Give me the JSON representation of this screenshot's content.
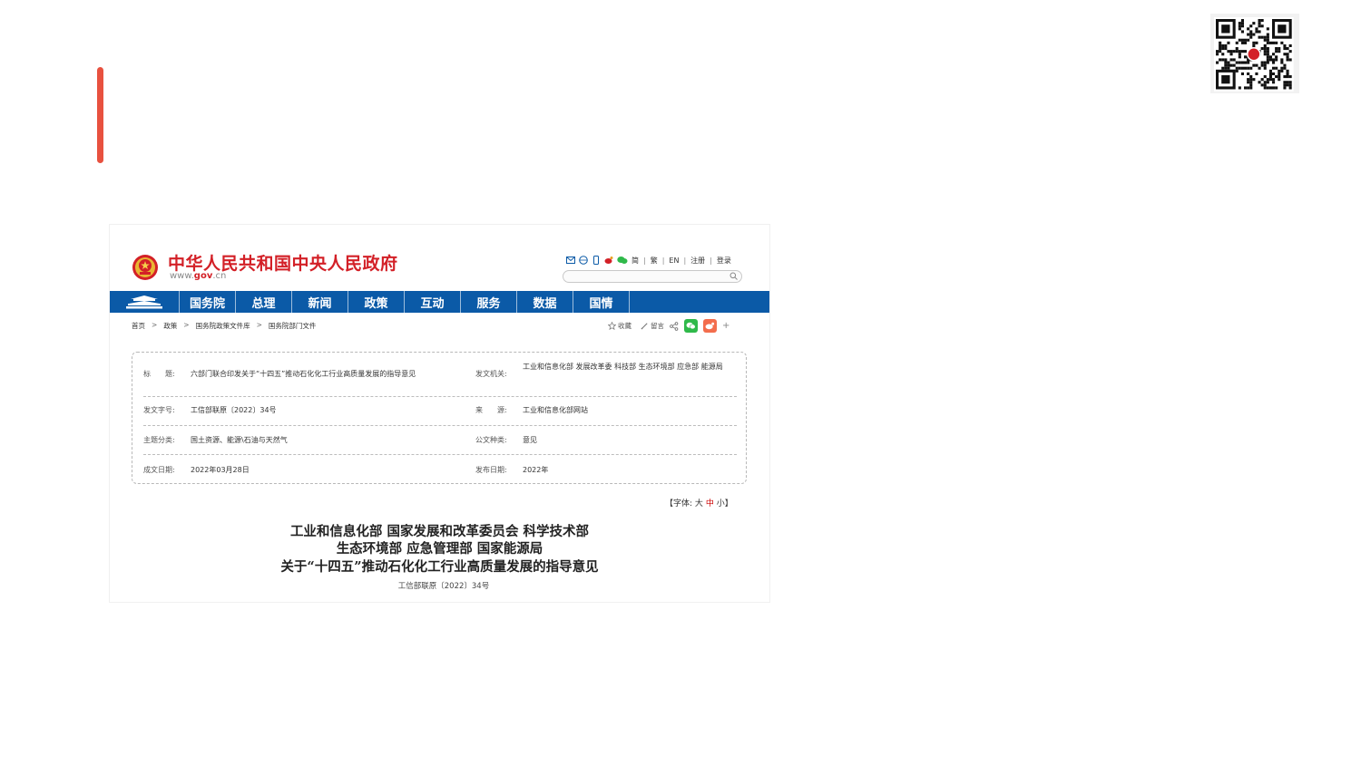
{
  "colors": {
    "accent": "#e8513f",
    "gov_blue": "#0b5aa7",
    "gov_red": "#d32027",
    "wechat_green": "#2fb94a",
    "weibo_orange": "#f36d4d"
  },
  "site": {
    "title": "中华人民共和国中央人民政府",
    "url_prefix": "www.",
    "url_domain": "gov",
    "url_suffix": ".cn",
    "tools": {
      "simplified": "简",
      "traditional": "繁",
      "english": "EN",
      "register": "注册",
      "login": "登录"
    },
    "search_placeholder": ""
  },
  "nav": {
    "items": [
      "国务院",
      "总理",
      "新闻",
      "政策",
      "互动",
      "服务",
      "数据",
      "国情"
    ]
  },
  "breadcrumb": {
    "items": [
      "首页",
      "政策",
      "国务院政策文件库",
      "国务院部门文件"
    ],
    "separator": ">"
  },
  "share": {
    "favorite": "收藏",
    "comment": "留言",
    "more": "+"
  },
  "info": {
    "title_label": "标　　题:",
    "title_value": "六部门联合印发关于“十四五”推动石化化工行业高质量发展的指导意见",
    "issuer_label": "发文机关:",
    "issuer_value": "工业和信息化部 发展改革委 科技部 生态环境部 应急部 能源局",
    "doc_no_label": "发文字号:",
    "doc_no_value": "工信部联原〔2022〕34号",
    "source_label": "来　　源:",
    "source_value": "工业和信息化部网站",
    "topic_label": "主题分类:",
    "topic_value": "国土资源、能源\\石油与天然气",
    "doc_type_label": "公文种类:",
    "doc_type_value": "意见",
    "written_label": "成文日期:",
    "written_value": "2022年03月28日",
    "publish_label": "发布日期:",
    "publish_value": "2022年"
  },
  "font_ctl": {
    "open": "【字体:",
    "large": "大",
    "medium": "中",
    "small": "小",
    "close": "】"
  },
  "doc": {
    "title_line1": "工业和信息化部 国家发展和改革委员会 科学技术部",
    "title_line2": "生态环境部 应急管理部 国家能源局",
    "title_line3": "关于“十四五”推动石化化工行业高质量发展的指导意见",
    "number": "工信部联原〔2022〕34号"
  }
}
